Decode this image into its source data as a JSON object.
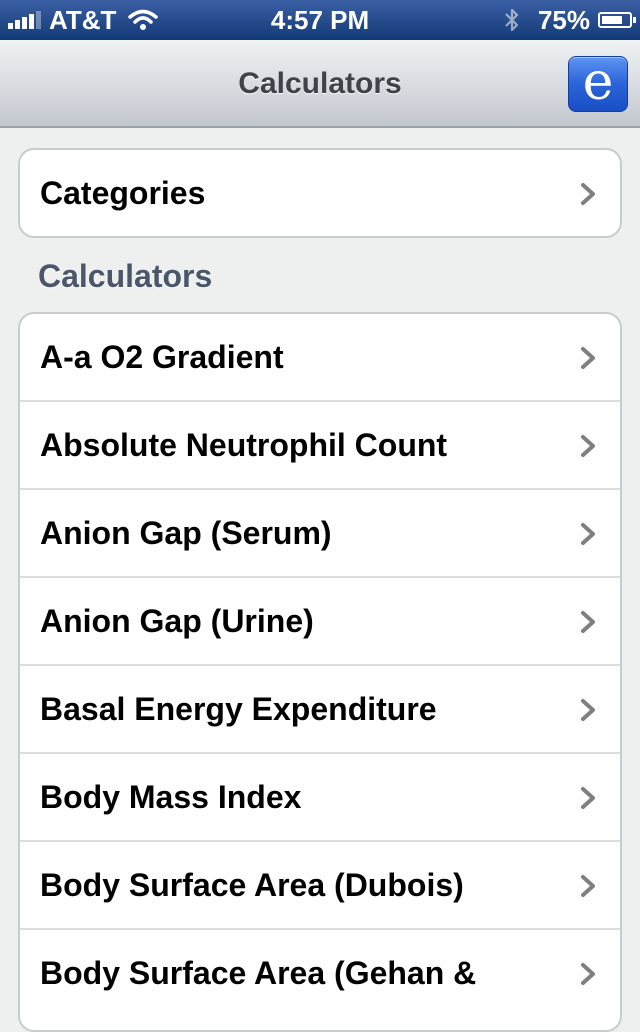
{
  "status_bar": {
    "carrier": "AT&T",
    "time": "4:57 PM",
    "battery": "75%"
  },
  "nav": {
    "title": "Calculators",
    "e_button_label": "e"
  },
  "categories_row": {
    "label": "Categories"
  },
  "section_header": "Calculators",
  "calculators": [
    {
      "label": "A-a O2 Gradient"
    },
    {
      "label": "Absolute Neutrophil Count"
    },
    {
      "label": "Anion Gap (Serum)"
    },
    {
      "label": "Anion Gap (Urine)"
    },
    {
      "label": "Basal Energy Expenditure"
    },
    {
      "label": "Body Mass Index"
    },
    {
      "label": "Body Surface Area (Dubois)"
    },
    {
      "label": "Body Surface Area (Gehan &"
    }
  ],
  "icons": {
    "signal": "signal-bars-icon",
    "wifi": "wifi-icon",
    "bluetooth": "bluetooth-icon",
    "battery": "battery-icon",
    "chevron": "chevron-right-icon"
  },
  "colors": {
    "status_bar": "#123a78",
    "nav_bar": "#d7dbe0",
    "accent_button": "#2b63d8",
    "section_header": "#4c566a",
    "background": "#eef0ef"
  }
}
